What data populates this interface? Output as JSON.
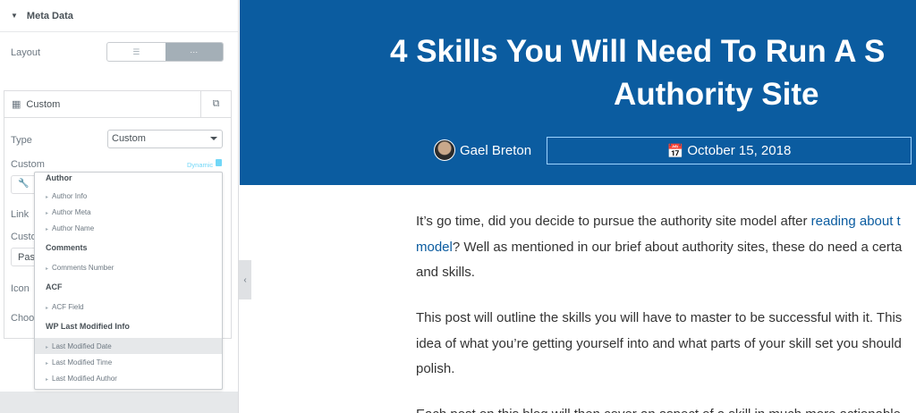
{
  "panel": {
    "section_title": "Meta Data",
    "layout_label": "Layout",
    "layout_options": [
      "☰",
      "···"
    ],
    "item_title": "Custom",
    "type_label": "Type",
    "type_value": "Custom",
    "custom_label": "Custom",
    "dynamic_label": "Dynamic",
    "link_label": "Link",
    "custom_stub_label": "Custo",
    "custom_stub_value": "Past",
    "icon_label": "Icon",
    "choose_label": "Choos"
  },
  "dropdown": {
    "groups": [
      {
        "title": "Author",
        "items": [
          "Author Info",
          "Author Meta",
          "Author Name"
        ]
      },
      {
        "title": "Comments",
        "items": [
          "Comments Number"
        ]
      },
      {
        "title": "ACF",
        "items": [
          "ACF Field"
        ]
      },
      {
        "title": "WP Last Modified Info",
        "items": [
          "Last Modified Date",
          "Last Modified Time",
          "Last Modified Author"
        ]
      }
    ],
    "highlighted": "Last Modified Date"
  },
  "post": {
    "title_line1": "4 Skills You Will Need To Run A S",
    "title_line2": "Authority Site",
    "author": "Gael Breton",
    "date": "October 15, 2018",
    "p1_line1_text": "It’s go time, did you decide to pursue the authority site model after ",
    "p1_line1_link": "reading about t",
    "p1_line2_link": "model",
    "p1_line2_text": "? Well as mentioned in our brief about authority sites, these do need a certa",
    "p1_line3": "and skills.",
    "p2_line1": "This post will outline the skills you will have to master to be successful with it. This",
    "p2_line2": "idea of what you’re getting yourself into and what parts of your skill set you should",
    "p2_line3": "polish.",
    "p3_line1": "Each post on this blog will then cover an aspect of a skill in much more actionable"
  },
  "colors": {
    "hero_bg": "#0b5ca0",
    "link": "#0b5ca0",
    "dynamic": "#71d7f7"
  }
}
